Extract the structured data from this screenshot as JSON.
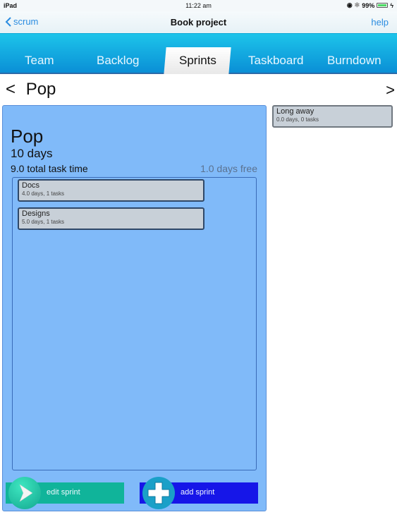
{
  "status_bar": {
    "device": "iPad",
    "time": "11:22 am",
    "battery": "99%"
  },
  "nav": {
    "back_label": "scrum",
    "title": "Book project",
    "help_label": "help"
  },
  "tabs": [
    {
      "label": "Team"
    },
    {
      "label": "Backlog"
    },
    {
      "label": "Sprints",
      "active": true
    },
    {
      "label": "Taskboard"
    },
    {
      "label": "Burndown"
    }
  ],
  "sprint_nav": {
    "prev_symbol": "<",
    "current": "Pop",
    "next_symbol": ">"
  },
  "sprint": {
    "name": "Pop",
    "duration": "10 days",
    "total_task_time": "9.0 total task time",
    "free": "1.0 days free",
    "stories": [
      {
        "name": "Docs",
        "meta": "4.0 days, 1 tasks"
      },
      {
        "name": "Designs",
        "meta": "5.0 days, 1 tasks"
      }
    ],
    "edit_label": "edit sprint",
    "add_label": "add sprint"
  },
  "backlog": [
    {
      "name": "Long away",
      "meta": "0.0 days, 0 tasks"
    }
  ],
  "colors": {
    "accent": "#2a8ce0",
    "sprint_bg": "#80baf9",
    "edit_btn": "#10b49a",
    "add_btn": "#1616e8"
  }
}
